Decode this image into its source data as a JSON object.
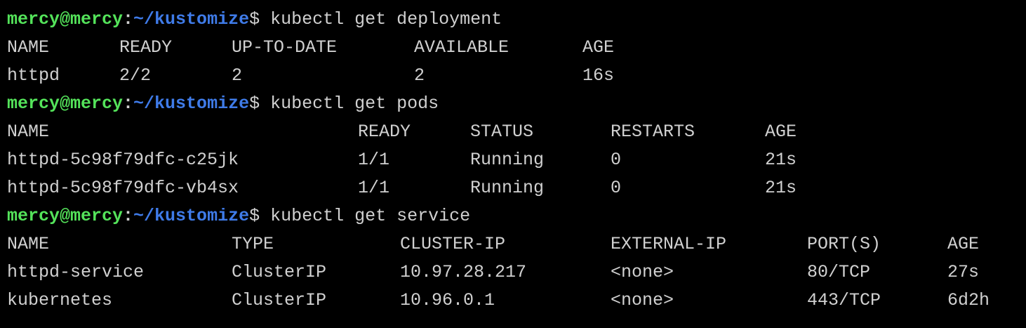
{
  "prompt": {
    "user_host": "mercy@mercy",
    "colon": ":",
    "path": "~/kustomize",
    "dollar": "$"
  },
  "colors": {
    "background": "#000000",
    "text": "#d0d0d0",
    "user_host": "#54e35a",
    "path": "#3f7be8"
  },
  "commands": [
    "kubectl get deployment",
    "kubectl get pods",
    "kubectl get service"
  ],
  "deployment": {
    "headers": [
      "NAME",
      "READY",
      "UP-TO-DATE",
      "AVAILABLE",
      "AGE"
    ],
    "rows": [
      [
        "httpd",
        "2/2",
        "2",
        "2",
        "16s"
      ]
    ]
  },
  "pods": {
    "headers": [
      "NAME",
      "READY",
      "STATUS",
      "RESTARTS",
      "AGE"
    ],
    "rows": [
      [
        "httpd-5c98f79dfc-c25jk",
        "1/1",
        "Running",
        "0",
        "21s"
      ],
      [
        "httpd-5c98f79dfc-vb4sx",
        "1/1",
        "Running",
        "0",
        "21s"
      ]
    ]
  },
  "service": {
    "headers": [
      "NAME",
      "TYPE",
      "CLUSTER-IP",
      "EXTERNAL-IP",
      "PORT(S)",
      "AGE"
    ],
    "rows": [
      [
        "httpd-service",
        "ClusterIP",
        "10.97.28.217",
        "<none>",
        "80/TCP",
        "27s"
      ],
      [
        "kubernetes",
        "ClusterIP",
        "10.96.0.1",
        "<none>",
        "443/TCP",
        "6d2h"
      ]
    ]
  }
}
